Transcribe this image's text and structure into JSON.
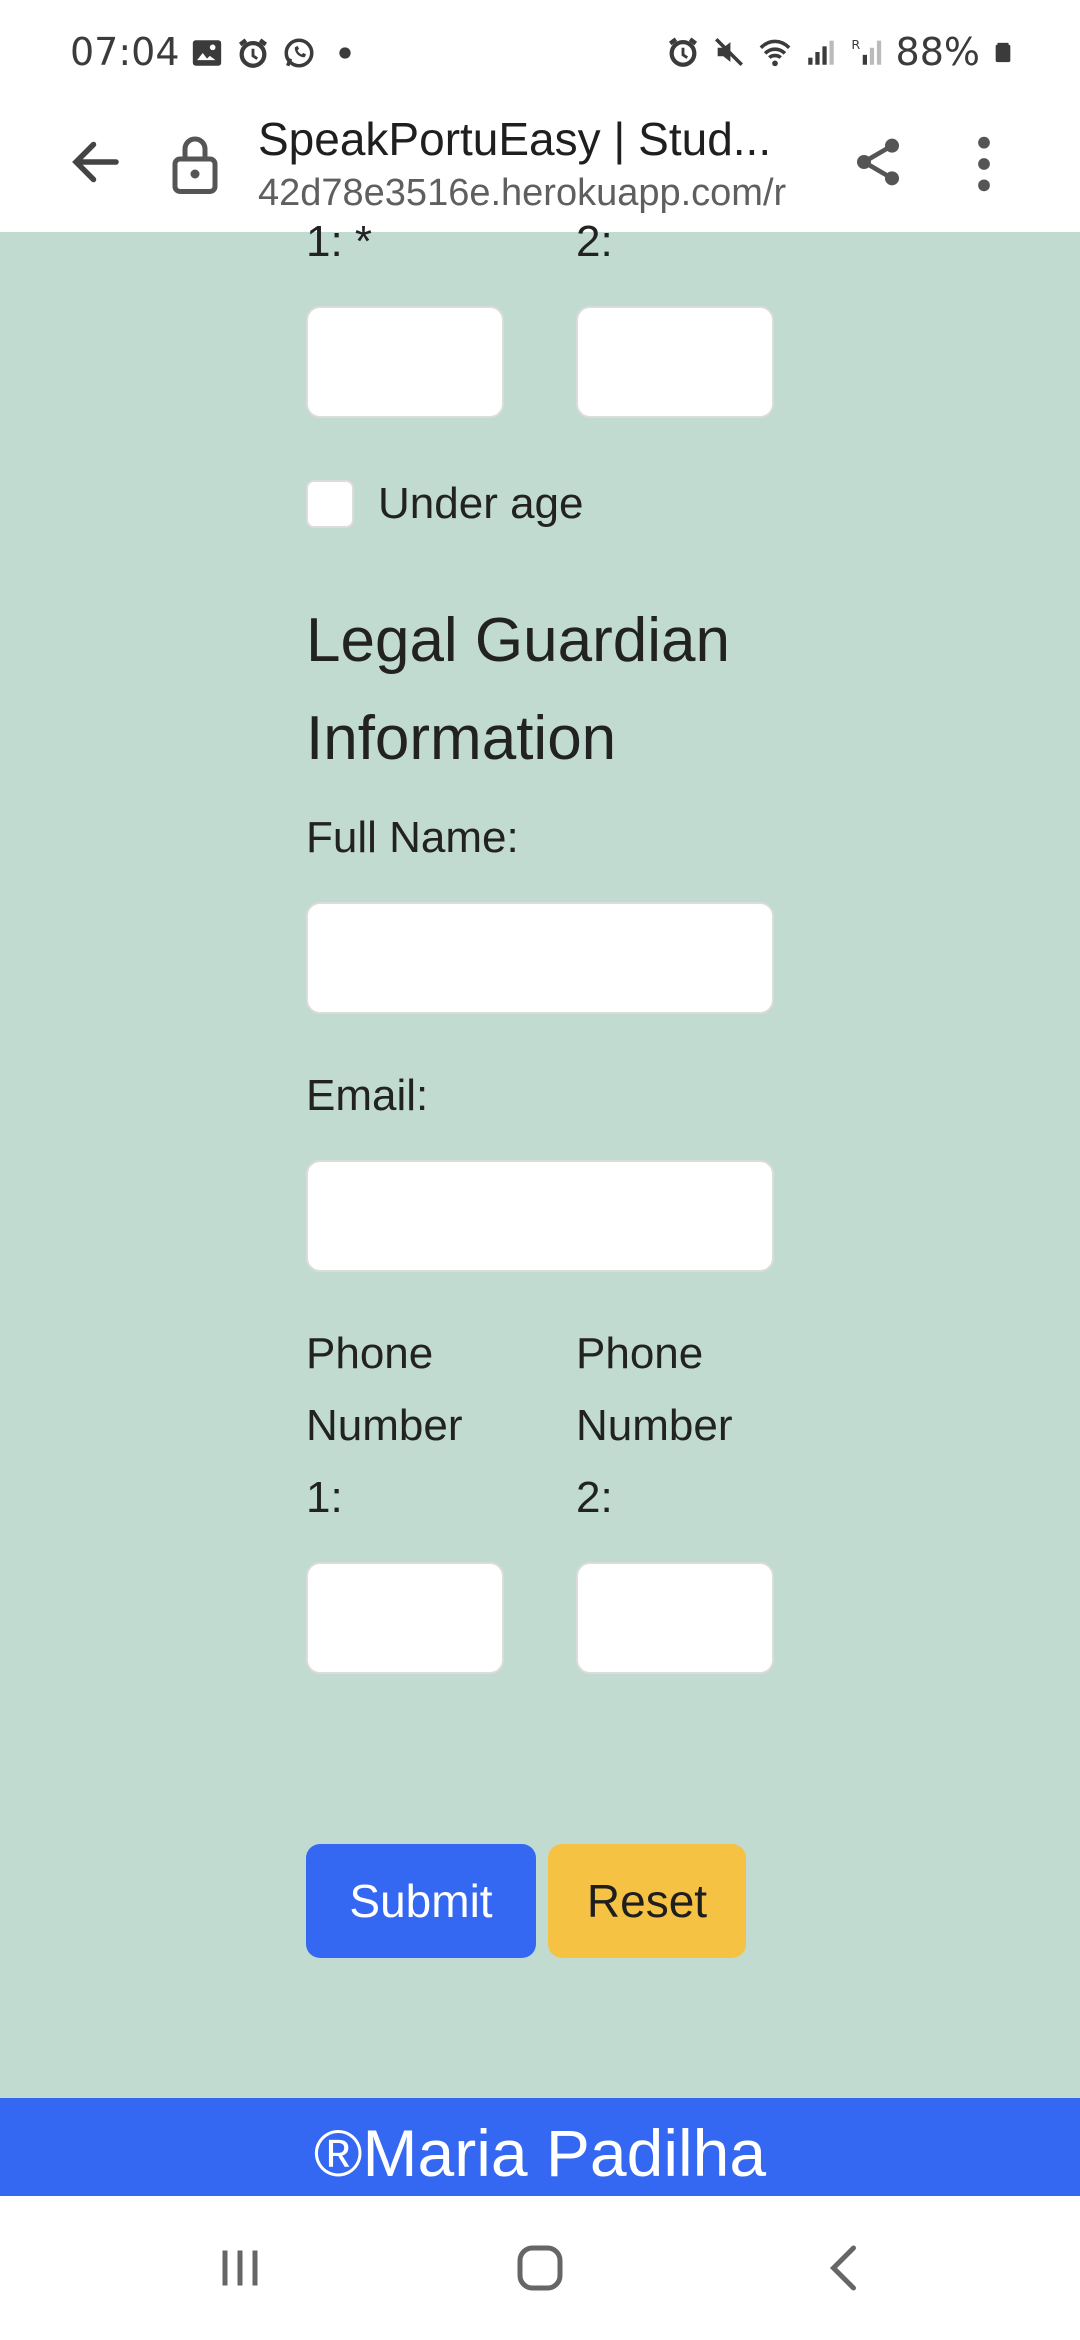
{
  "status_bar": {
    "time": "07:04",
    "battery": "88%",
    "left_icons": [
      "image-icon",
      "alarm-icon",
      "whatsapp-icon",
      "dot-icon"
    ],
    "right_icons": [
      "alarm-icon",
      "mute-icon",
      "wifi-icon",
      "signal-icon",
      "signal-roaming-icon",
      "battery-icon"
    ]
  },
  "browser": {
    "title": "SpeakPortuEasy | Stud...",
    "url": "42d78e3516e.herokuapp.com/r"
  },
  "form": {
    "top_label_1": "1: *",
    "top_label_2": "2:",
    "under_age_label": "Under age",
    "under_age_checked": false,
    "guardian_heading": "Legal Guardian Information",
    "full_name_label": "Full Name:",
    "full_name_value": "",
    "email_label": "Email:",
    "email_value": "",
    "phone1_label": "Phone Number 1:",
    "phone1_value": "",
    "phone2_label": "Phone Number 2:",
    "phone2_value": "",
    "submit_label": "Submit",
    "reset_label": "Reset"
  },
  "footer": {
    "text": "®Maria Padilha"
  },
  "colors": {
    "background": "#c2dbd0",
    "primary": "#3468f2",
    "warning": "#f5c244"
  }
}
